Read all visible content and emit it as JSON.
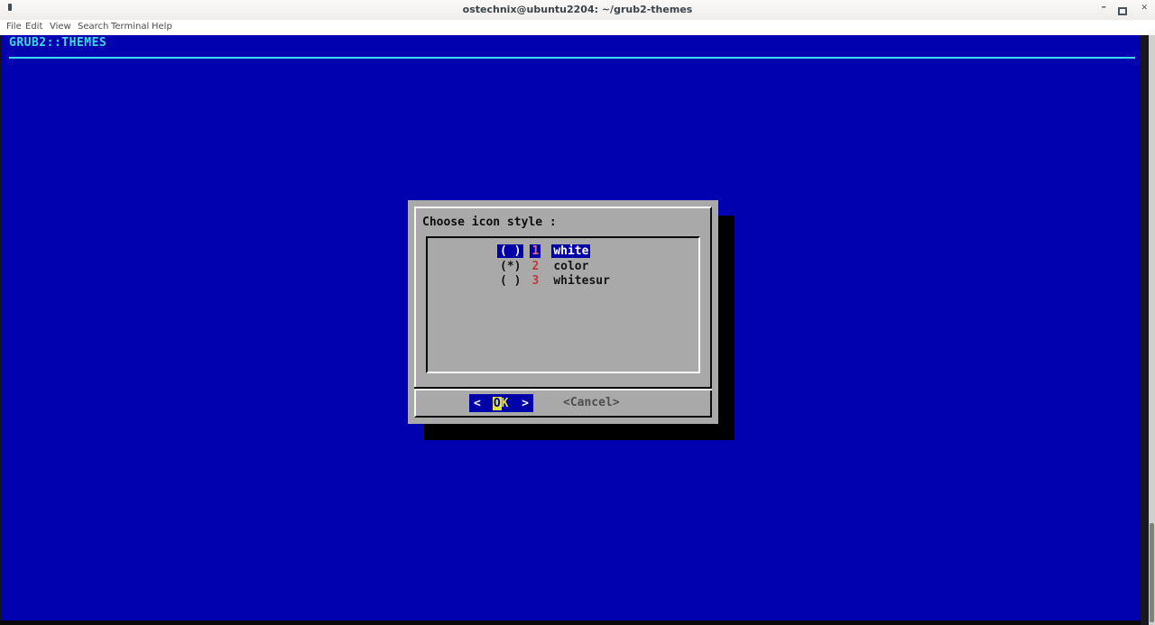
{
  "window": {
    "title": "ostechnix@ubuntu2204: ~/grub2-themes",
    "minimize_glyph": "–",
    "close_glyph": "✕"
  },
  "menubar": {
    "items": [
      "File",
      "Edit",
      "View",
      "Search",
      "Terminal",
      "Help"
    ]
  },
  "terminal": {
    "backtitle": "GRUB2::THEMES"
  },
  "dialog": {
    "title": "Choose icon style :",
    "options": [
      {
        "radio": "( )",
        "tag": "1",
        "label": "white",
        "selected": true
      },
      {
        "radio": "(*)",
        "tag": "2",
        "label": "color",
        "selected": false
      },
      {
        "radio": "( )",
        "tag": "3",
        "label": "whitesur",
        "selected": false
      }
    ],
    "ok": {
      "angle_left": "<",
      "cursor_char": "O",
      "rest": "K",
      "angle_right": ">"
    },
    "cancel_label": "<Cancel>"
  },
  "colors": {
    "screen_blue": "#0101b0",
    "selection_blue": "#0000a8",
    "dialog_gray": "#a9a9a9",
    "backtitle_cyan": "#3fd9e8",
    "tag_red": "#c03a3a",
    "tag_red_selected": "#e06a6a",
    "cursor_yellow": "#e3e13c",
    "shadow_black": "#000000"
  }
}
